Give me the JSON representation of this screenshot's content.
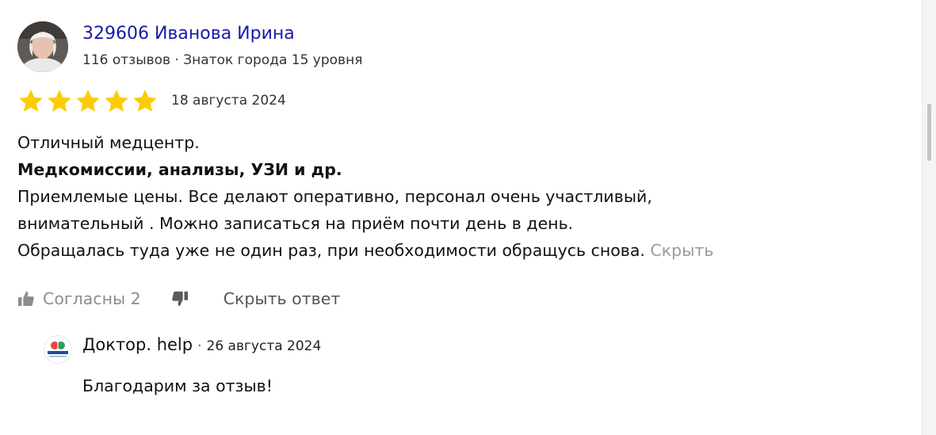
{
  "review": {
    "author_name": "329606 Иванова Ирина",
    "author_meta": "116 отзывов · Знаток города 15 уровня",
    "rating": 5,
    "rating_max": 5,
    "date": "18 августа 2024",
    "text_line_1": "Отличный медцентр.",
    "text_line_2": "Медкомиссии, анализы, УЗИ и др.",
    "text_line_3": "Приемлемые цены. Все делают оперативно, персонал очень участливый,",
    "text_line_4": "внимательный . Можно записаться на приём почти день в день.",
    "text_line_5": "Обращалась туда уже не один раз, при необходимости обращусь снова.",
    "collapse_label": "Скрыть"
  },
  "actions": {
    "agree_label": "Согласны 2",
    "hide_answer_label": "Скрыть ответ"
  },
  "reply": {
    "org_name": "Доктор. help",
    "separator": "·",
    "date": "26 августа 2024",
    "text": "Благодарим за отзыв!",
    "logo_text": "Доктор.help"
  },
  "icons": {
    "star": "star-icon",
    "like": "thumbs-up-icon",
    "dislike": "thumbs-down-icon"
  },
  "colors": {
    "star": "#fccc00",
    "author_link": "#1a1aa6",
    "muted": "#8c8c8c"
  }
}
